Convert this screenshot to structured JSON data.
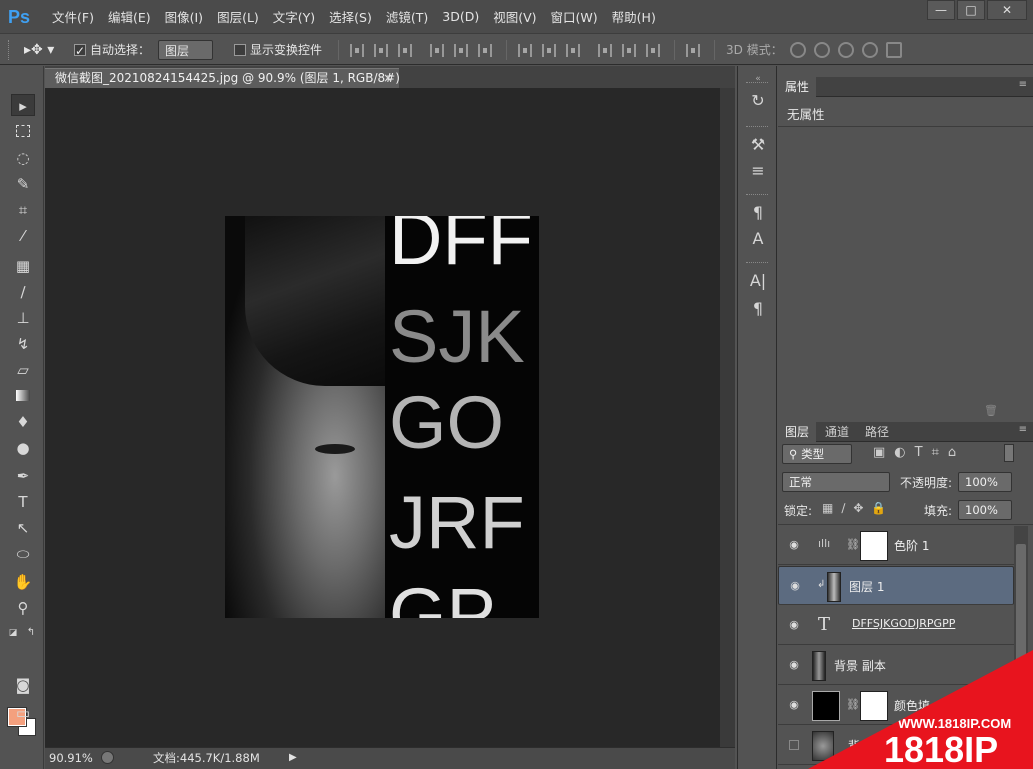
{
  "app": {
    "logo": "Ps"
  },
  "menu": [
    "文件(F)",
    "编辑(E)",
    "图像(I)",
    "图层(L)",
    "文字(Y)",
    "选择(S)",
    "滤镜(T)",
    "3D(D)",
    "视图(V)",
    "窗口(W)",
    "帮助(H)"
  ],
  "window_controls": {
    "minimize": "—",
    "maximize": "□",
    "close": "✕"
  },
  "options": {
    "auto_select_label": "自动选择：",
    "auto_select_checked": true,
    "auto_select_target": "图层",
    "show_transform_label": "显示变换控件",
    "show_transform_checked": false,
    "mode_3d_label": "3D 模式："
  },
  "document": {
    "tab_title": "微信截图_20210824154425.jpg @ 90.9% (图层 1, RGB/8#) *",
    "image_letters": [
      "DFF",
      "SJK",
      "GO",
      "JRF",
      "GP"
    ]
  },
  "status": {
    "zoom": "90.91%",
    "doc_size": "文档:445.7K/1.88M"
  },
  "properties_panel": {
    "tab": "属性",
    "empty_text": "无属性"
  },
  "layers_panel": {
    "tabs": [
      "图层",
      "通道",
      "路径"
    ],
    "filter_kind": "类型",
    "blend_mode": "正常",
    "opacity_label": "不透明度:",
    "opacity_value": "100%",
    "lock_label": "锁定:",
    "fill_label": "填充:",
    "fill_value": "100%",
    "layers": [
      {
        "name": "色阶 1",
        "type": "adjustment",
        "visible": true,
        "selected": false
      },
      {
        "name": "图层 1",
        "type": "pixel",
        "visible": true,
        "selected": true
      },
      {
        "name": "DFFSJKGODJRPGPP",
        "type": "text",
        "visible": true,
        "selected": false
      },
      {
        "name": "背景 副本",
        "type": "pixel",
        "visible": true,
        "selected": false
      },
      {
        "name": "颜色填",
        "type": "fill",
        "visible": true,
        "selected": false
      },
      {
        "name": "背",
        "type": "pixel",
        "visible": false,
        "selected": false
      }
    ]
  },
  "watermark": {
    "url": "WWW.1818IP.COM",
    "brand": "1818IP"
  },
  "colors": {
    "foreground": "#f4a07e",
    "background": "#ffffff",
    "accent": "#3fa0f2",
    "selection": "#5c6b80"
  }
}
